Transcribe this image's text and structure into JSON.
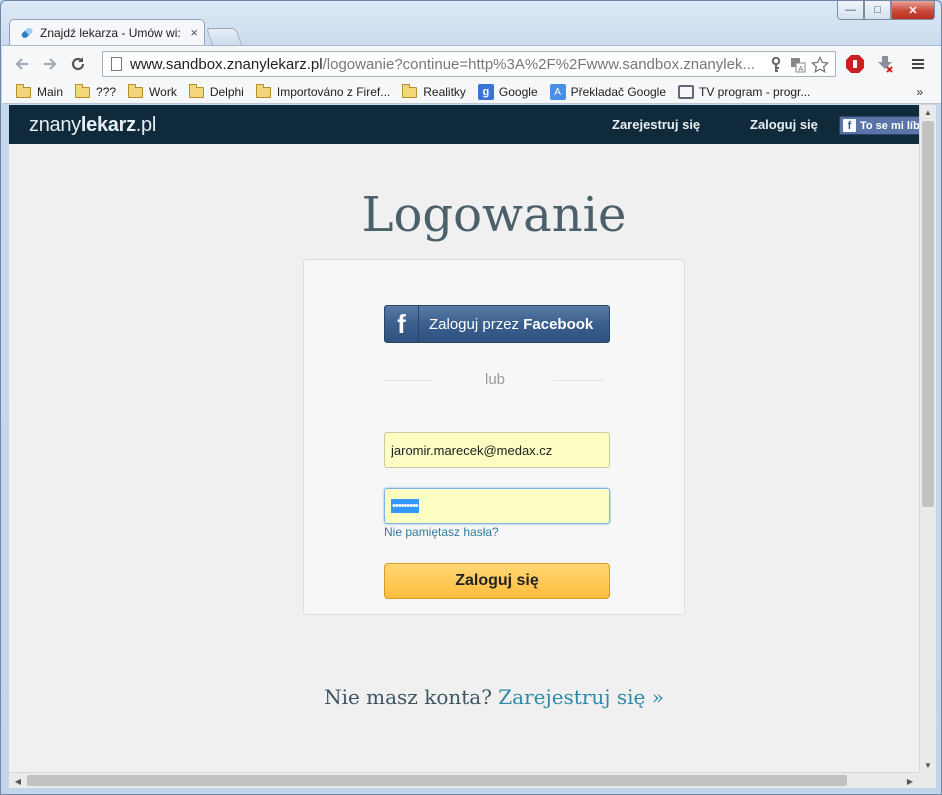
{
  "browser": {
    "tab_title": "Znajdź lekarza - Umów wi:",
    "tab_close": "×",
    "url_host": "www.sandbox.znanylekarz.pl",
    "url_path": "/logowanie?continue=http%3A%2F%2Fwww.sandbox.znanylek...",
    "window_min": "—",
    "window_max": "□",
    "window_close": "✕",
    "bookmarks": [
      {
        "label": "Main"
      },
      {
        "label": "???"
      },
      {
        "label": "Work"
      },
      {
        "label": "Delphi"
      },
      {
        "label": "Importováno z Firef..."
      },
      {
        "label": "Realitky"
      },
      {
        "label": "Google"
      },
      {
        "label": "Překladač Google"
      },
      {
        "label": "TV program - progr..."
      }
    ],
    "bookmarks_more": "»"
  },
  "site": {
    "logo_light": "znany",
    "logo_bold": "lekarz",
    "logo_tld": ".pl",
    "nav_register": "Zarejestruj się",
    "nav_login": "Zaloguj się",
    "fb_like_label": "To se mi líbí"
  },
  "login": {
    "title": "Logowanie",
    "facebook_prefix": "Zaloguj przez ",
    "facebook_bold": "Facebook",
    "divider": "lub",
    "email_value": "jaromir.marecek@medax.cz",
    "password_mask": "•••••••••",
    "forgot_password": "Nie pamiętasz hasła?",
    "submit": "Zaloguj się"
  },
  "footer": {
    "no_account": "Nie masz konta? ",
    "register_link": "Zarejestruj się »"
  },
  "colors": {
    "site_nav_bg": "#0e2a3b",
    "facebook_blue": "#3b5998",
    "submit_yellow": "#ffc24a",
    "link_teal": "#2f8aa8",
    "input_autofill": "#fcfdc1"
  }
}
